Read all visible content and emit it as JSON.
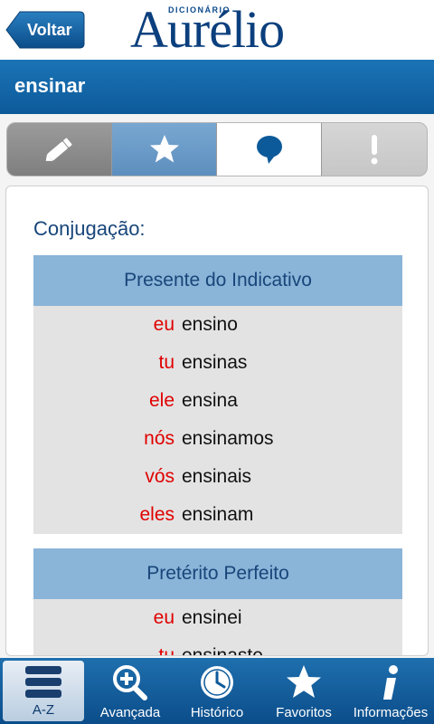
{
  "header": {
    "back_label": "Voltar",
    "logo_small": "DICIONÁRIO",
    "logo_main": "Aurélio"
  },
  "title_bar": {
    "title": "ensinar"
  },
  "segments": [
    {
      "icon": "pencil-icon"
    },
    {
      "icon": "star-icon"
    },
    {
      "icon": "speech-bubble-icon",
      "selected": true
    },
    {
      "icon": "exclamation-icon"
    }
  ],
  "content": {
    "label": "Conjugação:",
    "tables": [
      {
        "header": "Presente do Indicativo",
        "rows": [
          {
            "pronoun": "eu",
            "verb": "ensino"
          },
          {
            "pronoun": "tu",
            "verb": "ensinas"
          },
          {
            "pronoun": "ele",
            "verb": "ensina"
          },
          {
            "pronoun": "nós",
            "verb": "ensinamos"
          },
          {
            "pronoun": "vós",
            "verb": "ensinais"
          },
          {
            "pronoun": "eles",
            "verb": "ensinam"
          }
        ]
      },
      {
        "header": "Pretérito Perfeito",
        "rows": [
          {
            "pronoun": "eu",
            "verb": "ensinei"
          },
          {
            "pronoun": "tu",
            "verb": "ensinaste"
          }
        ]
      }
    ]
  },
  "tabbar": [
    {
      "label": "A-Z",
      "icon": "list-icon",
      "active": true
    },
    {
      "label": "Avançada",
      "icon": "magnifier-plus-icon"
    },
    {
      "label": "Histórico",
      "icon": "clock-icon"
    },
    {
      "label": "Favoritos",
      "icon": "star-icon"
    },
    {
      "label": "Informações",
      "icon": "info-icon"
    }
  ],
  "colors": {
    "brand_blue": "#0d5a9a",
    "pronoun_red": "#e00000",
    "table_header": "#8ab4d8"
  }
}
